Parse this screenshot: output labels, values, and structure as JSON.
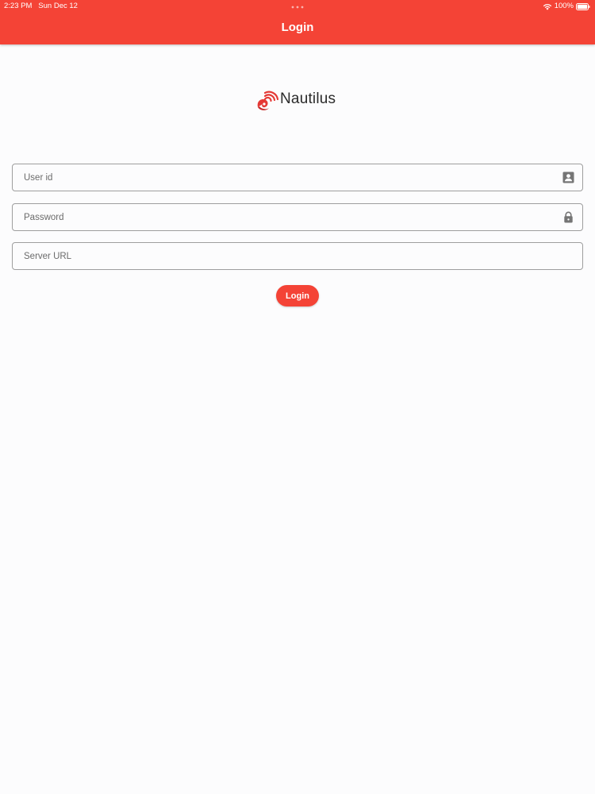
{
  "status_bar": {
    "time_date": "2:23 PM   Sun Dec 12",
    "battery": "100%"
  },
  "app_bar": {
    "title": "Login"
  },
  "logo": {
    "text": "Nautilus"
  },
  "form": {
    "user_id": {
      "placeholder": "User id",
      "value": "",
      "icon": "account-box-icon"
    },
    "password": {
      "placeholder": "Password",
      "value": "",
      "icon": "lock-icon"
    },
    "server_url": {
      "placeholder": "Server URL",
      "value": ""
    }
  },
  "login_button": {
    "label": "Login"
  },
  "colors": {
    "accent": "#f44336",
    "background": "#fcfcfd",
    "border": "#9e9e9e",
    "icon": "#757575"
  }
}
